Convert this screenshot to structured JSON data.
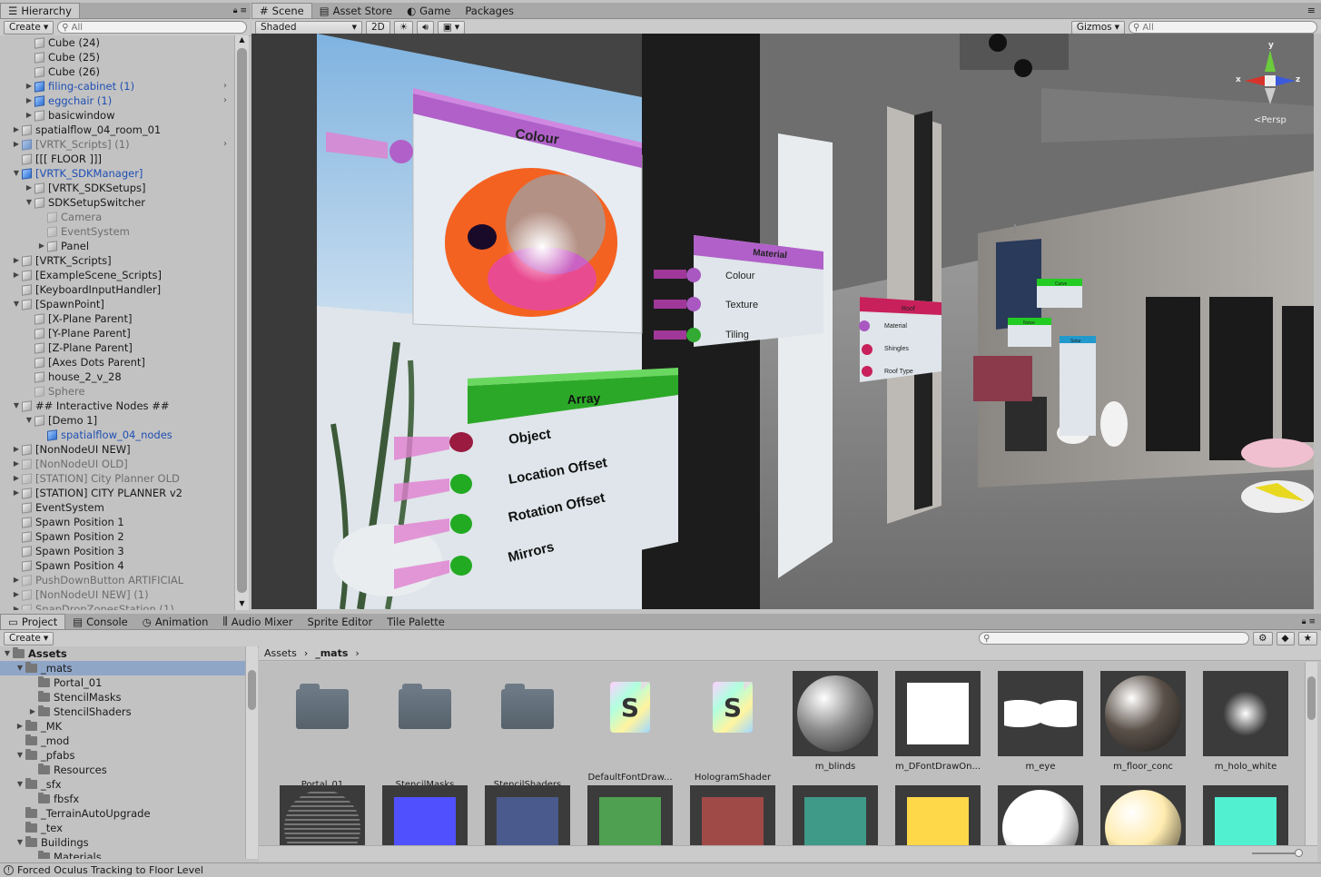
{
  "hierarchy": {
    "tab": "Hierarchy",
    "create": "Create",
    "search_placeholder": "All",
    "items": [
      {
        "label": "Cube (24)",
        "indent": 2
      },
      {
        "label": "Cube (25)",
        "indent": 2
      },
      {
        "label": "Cube (26)",
        "indent": 2
      },
      {
        "label": "filing-cabinet (1)",
        "indent": 2,
        "prefab": true,
        "fold": "right",
        "arrow": true
      },
      {
        "label": "eggchair (1)",
        "indent": 2,
        "prefab": true,
        "fold": "right",
        "arrow": true
      },
      {
        "label": "basicwindow",
        "indent": 2,
        "fold": "right"
      },
      {
        "label": "spatialflow_04_room_01",
        "indent": 1,
        "fold": "right"
      },
      {
        "label": "[VRTK_Scripts] (1)",
        "indent": 1,
        "fold": "right",
        "prefab": true,
        "inactive": true,
        "arrow": true
      },
      {
        "label": "[[[ FLOOR ]]]",
        "indent": 1
      },
      {
        "label": "[VRTK_SDKManager]",
        "indent": 1,
        "fold": "down",
        "prefab": true
      },
      {
        "label": "[VRTK_SDKSetups]",
        "indent": 2,
        "fold": "right"
      },
      {
        "label": "SDKSetupSwitcher",
        "indent": 2,
        "fold": "down"
      },
      {
        "label": "Camera",
        "indent": 3,
        "inactive": true
      },
      {
        "label": "EventSystem",
        "indent": 3,
        "inactive": true
      },
      {
        "label": "Panel",
        "indent": 3,
        "fold": "right"
      },
      {
        "label": "[VRTK_Scripts]",
        "indent": 1,
        "fold": "right"
      },
      {
        "label": "[ExampleScene_Scripts]",
        "indent": 1,
        "fold": "right"
      },
      {
        "label": "[KeyboardInputHandler]",
        "indent": 1
      },
      {
        "label": "[SpawnPoint]",
        "indent": 1,
        "fold": "down"
      },
      {
        "label": "[X-Plane Parent]",
        "indent": 2
      },
      {
        "label": "[Y-Plane Parent]",
        "indent": 2
      },
      {
        "label": "[Z-Plane Parent]",
        "indent": 2
      },
      {
        "label": "[Axes Dots Parent]",
        "indent": 2
      },
      {
        "label": "house_2_v_28",
        "indent": 2
      },
      {
        "label": "Sphere",
        "indent": 2,
        "inactive": true
      },
      {
        "label": "## Interactive Nodes ##",
        "indent": 1,
        "fold": "down"
      },
      {
        "label": "[Demo 1]",
        "indent": 2,
        "fold": "down"
      },
      {
        "label": "spatialflow_04_nodes",
        "indent": 3,
        "prefab": true,
        "plain": true
      },
      {
        "label": "[NonNodeUI NEW]",
        "indent": 1,
        "fold": "right"
      },
      {
        "label": "[NonNodeUI OLD]",
        "indent": 1,
        "fold": "right",
        "inactive": true
      },
      {
        "label": "[STATION] City Planner OLD",
        "indent": 1,
        "fold": "right",
        "inactive": true
      },
      {
        "label": "[STATION] CITY PLANNER v2",
        "indent": 1,
        "fold": "right"
      },
      {
        "label": "EventSystem",
        "indent": 1
      },
      {
        "label": "Spawn Position 1",
        "indent": 1
      },
      {
        "label": "Spawn Position 2",
        "indent": 1
      },
      {
        "label": "Spawn Position 3",
        "indent": 1
      },
      {
        "label": "Spawn Position 4",
        "indent": 1
      },
      {
        "label": "PushDownButton ARTIFICIAL",
        "indent": 1,
        "fold": "right",
        "inactive": true
      },
      {
        "label": "[NonNodeUI NEW] (1)",
        "indent": 1,
        "fold": "right",
        "inactive": true
      },
      {
        "label": "SnapDropZonesStation (1)",
        "indent": 1,
        "fold": "right",
        "inactive": true
      }
    ]
  },
  "scene_tabs": [
    {
      "label": "Scene",
      "icon": "scene-icon",
      "active": true
    },
    {
      "label": "Asset Store",
      "icon": "store-icon"
    },
    {
      "label": "Game",
      "icon": "game-icon"
    },
    {
      "label": "Packages",
      "icon": ""
    }
  ],
  "scene_toolbar": {
    "shading": "Shaded",
    "mode_2d": "2D",
    "gizmos": "Gizmos",
    "search_placeholder": "All"
  },
  "scene": {
    "gizmo": {
      "x": "x",
      "y": "y",
      "z": "z",
      "persp": "<Persp"
    },
    "colour_node": {
      "title": "Colour"
    },
    "material_node": {
      "title": "Material",
      "rows": [
        "Colour",
        "Texture",
        "Tiling"
      ]
    },
    "roof_node": {
      "title": "Roof",
      "rows": [
        "Material",
        "Shingles",
        "Roof Type"
      ]
    },
    "array_node": {
      "title": "Array",
      "rows": [
        "Object",
        "Location Offset",
        "Rotation Offset",
        "Mirrors"
      ]
    },
    "far_node_a": {
      "title": "Curve"
    },
    "far_node_b": {
      "title": "Noise"
    },
    "far_node_c": {
      "title": "Solar"
    }
  },
  "bottom_tabs": [
    {
      "label": "Project",
      "icon": "folder-icon",
      "active": true
    },
    {
      "label": "Console",
      "icon": "console-icon"
    },
    {
      "label": "Animation",
      "icon": "animation-icon"
    },
    {
      "label": "Audio Mixer",
      "icon": "mixer-icon"
    },
    {
      "label": "Sprite Editor",
      "icon": ""
    },
    {
      "label": "Tile Palette",
      "icon": ""
    }
  ],
  "project": {
    "create": "Create",
    "tree": [
      {
        "label": "Assets",
        "indent": 0,
        "fold": "down",
        "bold": true
      },
      {
        "label": "_mats",
        "indent": 1,
        "fold": "down",
        "selected": true
      },
      {
        "label": "Portal_01",
        "indent": 2
      },
      {
        "label": "StencilMasks",
        "indent": 2
      },
      {
        "label": "StencilShaders",
        "indent": 2,
        "fold": "right"
      },
      {
        "label": "_MK",
        "indent": 1,
        "fold": "right"
      },
      {
        "label": "_mod",
        "indent": 1
      },
      {
        "label": "_pfabs",
        "indent": 1,
        "fold": "down"
      },
      {
        "label": "Resources",
        "indent": 2
      },
      {
        "label": "_sfx",
        "indent": 1,
        "fold": "down"
      },
      {
        "label": "fbsfx",
        "indent": 2
      },
      {
        "label": "_TerrainAutoUpgrade",
        "indent": 1
      },
      {
        "label": "_tex",
        "indent": 1
      },
      {
        "label": "Buildings",
        "indent": 1,
        "fold": "down"
      },
      {
        "label": "Materials",
        "indent": 2
      }
    ],
    "breadcrumb": [
      "Assets",
      "_mats"
    ],
    "assets_row1": [
      {
        "label": "Portal_01",
        "kind": "folder"
      },
      {
        "label": "StencilMasks",
        "kind": "folder"
      },
      {
        "label": "StencilShaders",
        "kind": "folder"
      },
      {
        "label": "DefaultFontDraw...",
        "kind": "shader"
      },
      {
        "label": "HologramShader",
        "kind": "shader"
      },
      {
        "label": "m_blinds",
        "kind": "sphere",
        "color": "#8a8a8a"
      },
      {
        "label": "m_DFontDrawOn...",
        "kind": "square",
        "color": "#ffffff"
      },
      {
        "label": "m_eye",
        "kind": "eye"
      },
      {
        "label": "m_floor_conc",
        "kind": "sphere",
        "color": "#5a5048"
      },
      {
        "label": "m_holo_white",
        "kind": "glow"
      }
    ],
    "assets_row2": [
      {
        "kind": "mesh"
      },
      {
        "kind": "square",
        "color": "#5050ff"
      },
      {
        "kind": "square",
        "color": "#4b5a8c"
      },
      {
        "kind": "square",
        "color": "#4fa050"
      },
      {
        "kind": "square",
        "color": "#a04a48"
      },
      {
        "kind": "square",
        "color": "#3f9a88"
      },
      {
        "kind": "square",
        "color": "#ffd84a"
      },
      {
        "kind": "sphere",
        "color": "#ffffff"
      },
      {
        "kind": "sphere",
        "color": "#ffecb0"
      },
      {
        "kind": "square",
        "color": "#50f0d0"
      }
    ]
  },
  "status": "Forced Oculus Tracking to Floor Level"
}
